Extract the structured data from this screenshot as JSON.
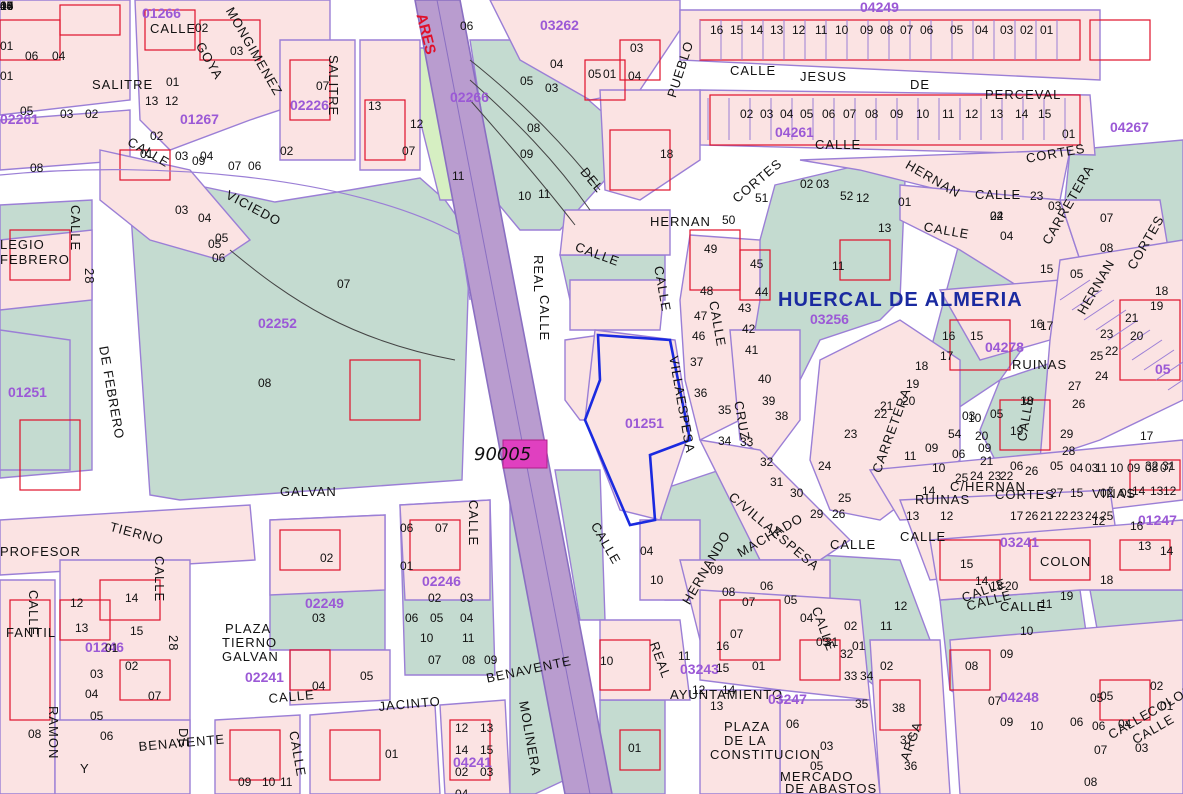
{
  "map": {
    "colors": {
      "street": "#ffffff",
      "parcel": "#fbe3e3",
      "green": "#c4dbd0",
      "outline": "#9b7fd6",
      "building": "#e0102a",
      "railway": "#b99ccf",
      "highlight": "#1a2ae0",
      "code": "#9b59d6"
    },
    "town_name": "HUERCAL DE ALMERIA",
    "road_number": "90005",
    "railway_label": "ARES",
    "streets": {
      "s01": "CALLE",
      "s02": "GOYA",
      "s03": "MONGIMENEZ",
      "s04": "SALITRE",
      "s05": "SALITRE",
      "s06": "CALLE",
      "s07": "VICIEDO",
      "s08": "CALLE",
      "s09": "28",
      "s10": "DE FEBRERO",
      "s11": "CALLE",
      "s12": "JESUS",
      "s13": "DE",
      "s14": "PERCEVAL",
      "s15": "PUEBLO",
      "s16": "DEL",
      "s17": "CORTES",
      "s18": "CALLE",
      "s19": "HERNAN",
      "s20": "CORTES",
      "s21": "CALLE",
      "s22": "HERNAN",
      "s23": "CALLE",
      "s24": "CARRETERA",
      "s25": "HERNAN",
      "s26": "CORTES",
      "s27": "CALLE",
      "s28": "REAL",
      "s29": "CALLE",
      "s30": "CALLE",
      "s31": "CALLE",
      "s32": "VILLAESPESA",
      "s33": "CRUZ",
      "s34": "RUINAS",
      "s35": "CALLE",
      "s36": "CARRETERA",
      "s37": "RUINAS",
      "s38": "C/HERNAN",
      "s39": "CORTES",
      "s40": "VIÑAS",
      "s41": "C/VILLAESPESA",
      "s42": "CALLE",
      "s43": "MACHADO",
      "s44": "CALLE",
      "s45": "COLON",
      "s46": "CALLE",
      "s47": "GALVAN",
      "s48": "TIERNO",
      "s49": "PROFESOR",
      "s50": "CALLE",
      "s51": "CALLE",
      "s52": "28",
      "s53": "CALLE",
      "s54": "PLAZA",
      "s55": "TIERNO",
      "s56": "GALVAN",
      "s57": "CALLE",
      "s58": "FANTIL",
      "s59": "RAMON",
      "s60": "Y",
      "s61": "DE",
      "s62": "CALLE",
      "s63": "JACINTO",
      "s64": "BENAVENTE",
      "s65": "BENAVENTE",
      "s66": "CALLE",
      "s67": "MOLINERA",
      "s68": "CALLE",
      "s69": "REAL",
      "s70": "HERNANDO",
      "s71": "AYUNTAMIENTO",
      "s72": "PLAZA",
      "s73": "DE LA",
      "s74": "CONSTITUCION",
      "s75": "MERCADO",
      "s76": "DE ABASTOS",
      "s77": "CALLE",
      "s78": "ARGA",
      "s79": "CALLE",
      "s80": "COLON",
      "s81": "CALLE",
      "s82": "CALLE",
      "s83": "LEGIO",
      "s84": "FEBRERO"
    },
    "codes": {
      "c01": "01266",
      "c02": "03262",
      "c03": "02261",
      "c04": "02226",
      "c05": "02266",
      "c06": "01267",
      "c07": "04261",
      "c08": "04267",
      "c09": "02252",
      "c10": "01251",
      "c11": "03256",
      "c12": "04278",
      "c13": "05",
      "c14": "01251",
      "c15": "02249",
      "c16": "02246",
      "c17": "01246",
      "c18": "03241",
      "c19": "03243",
      "c20": "04248",
      "c21": "03247",
      "c22": "01247",
      "c23": "04241",
      "c24": "02241",
      "c25": "04249"
    },
    "numbers": {
      "n001": "01",
      "n002": "06",
      "n003": "04",
      "n004": "05",
      "n005": "02",
      "n006": "03",
      "n007": "01",
      "n008": "03",
      "n009": "02",
      "n010": "08",
      "n011": "05",
      "n012": "04",
      "n013": "03",
      "n014": "02",
      "n015": "13",
      "n016": "12",
      "n017": "02",
      "n018": "07",
      "n019": "11",
      "n020": "13",
      "n021": "12",
      "n022": "01",
      "n023": "09",
      "n024": "07",
      "n025": "06",
      "n026": "01",
      "n027": "03",
      "n028": "04",
      "n029": "05",
      "n030": "06",
      "n031": "07",
      "n032": "08",
      "n033": "07",
      "n034": "06",
      "n035": "05",
      "n036": "04",
      "n037": "03",
      "n038": "08",
      "n039": "09",
      "n040": "10",
      "n041": "11",
      "n042": "18",
      "n043": "03",
      "n044": "04",
      "n045": "05",
      "n046": "01",
      "n047": "16",
      "n048": "15",
      "n049": "14",
      "n050": "13",
      "n051": "12",
      "n052": "11",
      "n053": "10",
      "n054": "09",
      "n055": "08",
      "n056": "07",
      "n057": "06",
      "n058": "05",
      "n059": "04",
      "n060": "03",
      "n061": "02",
      "n062": "01",
      "n063": "02",
      "n064": "03",
      "n065": "04",
      "n066": "05",
      "n067": "06",
      "n068": "07",
      "n069": "08",
      "n070": "09",
      "n071": "10",
      "n072": "11",
      "n073": "12",
      "n074": "13",
      "n075": "14",
      "n076": "15",
      "n077": "01",
      "n078": "02",
      "n079": "03",
      "n080": "52",
      "n081": "51",
      "n082": "50",
      "n083": "49",
      "n084": "48",
      "n085": "47",
      "n086": "46",
      "n087": "45",
      "n088": "44",
      "n089": "43",
      "n090": "42",
      "n091": "41",
      "n092": "40",
      "n093": "39",
      "n094": "38",
      "n095": "37",
      "n096": "36",
      "n097": "35",
      "n098": "34",
      "n099": "33",
      "n100": "32",
      "n101": "31",
      "n102": "30",
      "n103": "29",
      "n104": "26",
      "n105": "25",
      "n106": "24",
      "n107": "23",
      "n108": "22",
      "n109": "21",
      "n110": "20",
      "n111": "19",
      "n112": "18",
      "n113": "17",
      "n114": "16",
      "n115": "15",
      "n116": "14",
      "n117": "13",
      "n118": "12",
      "n119": "11",
      "n120": "10",
      "n121": "09",
      "n122": "54",
      "n123": "03",
      "n124": "05",
      "n125": "06",
      "n126": "09",
      "n127": "10",
      "n128": "11",
      "n129": "12",
      "n130": "13",
      "n131": "01",
      "n132": "02",
      "n133": "24",
      "n134": "23",
      "n135": "03",
      "n136": "04",
      "n137": "07",
      "n138": "08",
      "n139": "05",
      "n140": "15",
      "n141": "17",
      "n142": "16",
      "n143": "19",
      "n144": "18",
      "n145": "21",
      "n146": "20",
      "n147": "23",
      "n148": "22",
      "n149": "25",
      "n150": "24",
      "n151": "27",
      "n152": "26",
      "n153": "29",
      "n154": "28",
      "n155": "32",
      "n156": "31",
      "n157": "17",
      "n158": "18",
      "n159": "19",
      "n160": "20",
      "n161": "21",
      "n162": "22",
      "n163": "23",
      "n164": "24",
      "n165": "25",
      "n166": "26",
      "n167": "27",
      "n168": "15",
      "n169": "14",
      "n170": "13",
      "n171": "12",
      "n172": "11",
      "n173": "10",
      "n174": "09",
      "n175": "08",
      "n176": "07",
      "n177": "06",
      "n178": "05",
      "n179": "04",
      "n180": "03",
      "n181": "02",
      "n182": "01",
      "n183": "17",
      "n184": "26",
      "n185": "21",
      "n186": "22",
      "n187": "23",
      "n188": "24",
      "n189": "25",
      "n190": "15",
      "n191": "14",
      "n192": "13",
      "n193": "20",
      "n194": "19",
      "n195": "18",
      "n196": "16",
      "n197": "14",
      "n198": "13",
      "n199": "12",
      "n200": "11",
      "n201": "10",
      "n202": "09",
      "n203": "08",
      "n204": "07",
      "n205": "06",
      "n206": "05",
      "n207": "04",
      "n208": "03",
      "n209": "02",
      "n210": "01",
      "n211": "04",
      "n212": "10",
      "n213": "09",
      "n214": "08",
      "n215": "07",
      "n216": "06",
      "n217": "05",
      "n218": "04",
      "n219": "03",
      "n220": "02",
      "n221": "01",
      "n222": "02",
      "n223": "38",
      "n224": "37",
      "n225": "36",
      "n226": "35",
      "n227": "34",
      "n228": "33",
      "n229": "32",
      "n230": "31",
      "n231": "03",
      "n232": "05",
      "n233": "06",
      "n234": "07",
      "n235": "01",
      "n236": "16",
      "n237": "15",
      "n238": "14",
      "n239": "13",
      "n240": "12",
      "n241": "11",
      "n242": "10",
      "n243": "01",
      "n244": "02",
      "n245": "03",
      "n246": "04",
      "n247": "05",
      "n248": "06",
      "n249": "07",
      "n250": "01",
      "n251": "02",
      "n252": "03",
      "n253": "04",
      "n254": "05",
      "n255": "06",
      "n256": "07",
      "n257": "08",
      "n258": "09",
      "n259": "10",
      "n260": "11",
      "n261": "12",
      "n262": "13",
      "n263": "14",
      "n264": "15",
      "n265": "01",
      "n266": "02",
      "n267": "03",
      "n268": "04",
      "n269": "05",
      "n270": "06",
      "n271": "07",
      "n272": "08",
      "n273": "09",
      "n274": "10",
      "n275": "11",
      "n276": "12",
      "n277": "13",
      "n278": "14",
      "n279": "15",
      "n280": "01",
      "n281": "02",
      "n282": "03",
      "n283": "04",
      "n284": "05",
      "n285": "06",
      "n286": "07",
      "n287": "08",
      "n288": "09",
      "n289": "10",
      "n290": "11",
      "n291": "12",
      "n292": "13",
      "n293": "14",
      "n294": "15",
      "n295": "16",
      "n296": "17",
      "n297": "18",
      "n298": "40",
      "n299": "03",
      "n300": "04"
    }
  }
}
